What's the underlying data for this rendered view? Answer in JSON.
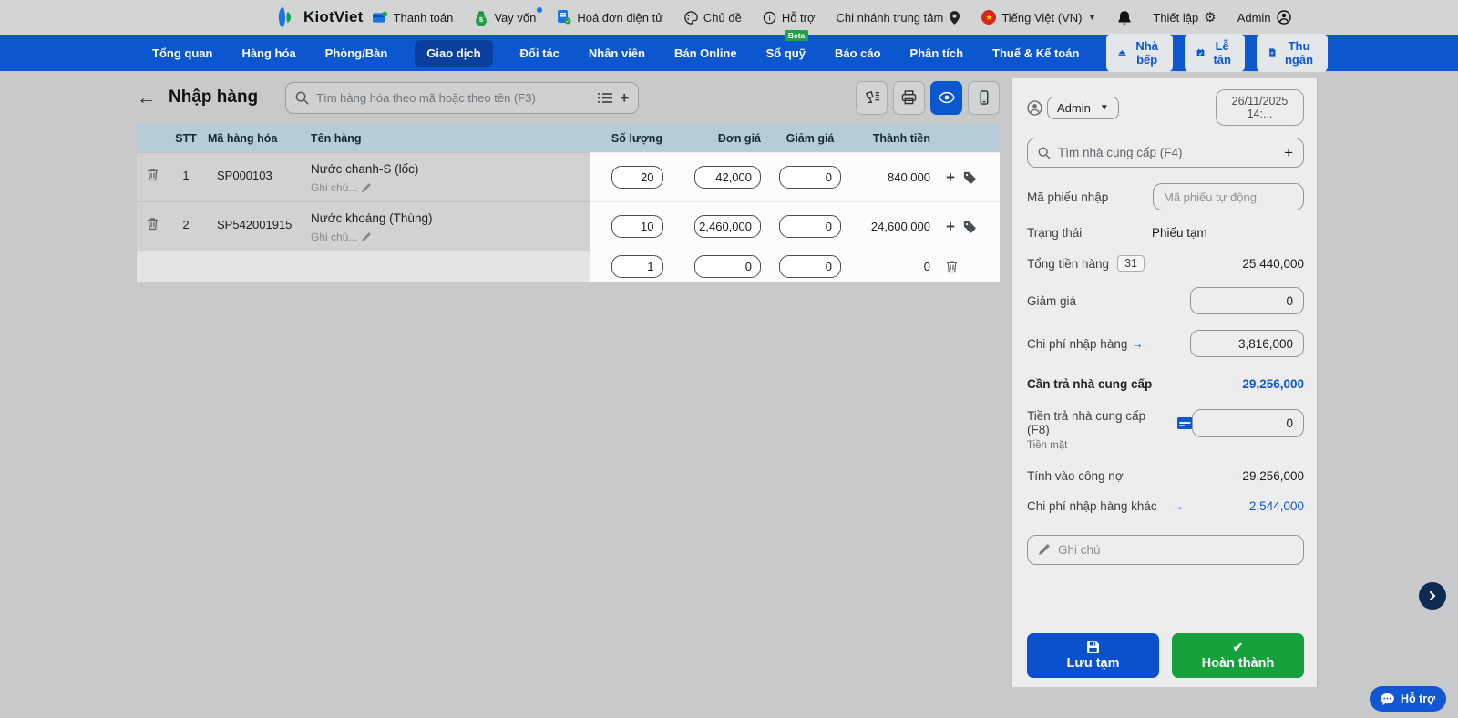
{
  "topbar": {
    "brand": "KiotViet",
    "links": [
      {
        "label": "Thanh toán"
      },
      {
        "label": "Vay vốn"
      },
      {
        "label": "Hoá đơn điện tử"
      },
      {
        "label": "Chủ đề"
      },
      {
        "label": "Hỗ trợ",
        "badge": "Beta"
      },
      {
        "label": "Chi nhánh trung tâm"
      },
      {
        "label": "Tiếng Việt (VN)"
      },
      {
        "label": "Thiết lập"
      },
      {
        "label": "Admin"
      }
    ],
    "flag_star": "★"
  },
  "nav": {
    "items": [
      "Tổng quan",
      "Hàng hóa",
      "Phòng/Bàn",
      "Giao dịch",
      "Đối tác",
      "Nhân viên",
      "Bán Online",
      "Sổ quỹ",
      "Báo cáo",
      "Phân tích",
      "Thuế & Kế toán"
    ],
    "active": "Giao dịch",
    "quick": [
      "Nhà bếp",
      "Lễ tân",
      "Thu ngân"
    ]
  },
  "main": {
    "title": "Nhập hàng",
    "search": {
      "placeholder": "Tìm hàng hóa theo mã hoặc theo tên (F3)"
    },
    "table": {
      "headers": [
        "STT",
        "Mã hàng hóa",
        "Tên hàng",
        "Số lượng",
        "Đơn giá",
        "Giảm giá",
        "Thành tiền"
      ],
      "rows": [
        {
          "stt": "1",
          "code": "SP000103",
          "name": "Nước chanh-S (lốc)",
          "note": "Ghi chú...",
          "qty": "20",
          "price": "42,000",
          "discount": "0",
          "total": "840,000"
        },
        {
          "stt": "2",
          "code": "SP542001915",
          "name": "Nước khoáng (Thùng)",
          "note": "Ghi chú...",
          "qty": "10",
          "price": "2,460,000",
          "discount": "0",
          "total": "24,600,000"
        }
      ],
      "empty_row": {
        "qty": "1",
        "price": "0",
        "discount": "0",
        "total": "0"
      }
    }
  },
  "sidebar": {
    "user": "Admin",
    "datetime": "26/11/2025 14:...",
    "supplier_search": {
      "placeholder": "Tìm nhà cung cấp (F4)"
    },
    "code": {
      "label": "Mã phiếu nhập",
      "placeholder": "Mã phiếu tự động"
    },
    "status": {
      "label": "Trạng thái",
      "value": "Phiếu tạm"
    },
    "total": {
      "label": "Tổng tiền hàng",
      "badge": "31",
      "value": "25,440,000"
    },
    "discount": {
      "label": "Giảm giá",
      "value": "0"
    },
    "cost": {
      "label": "Chi phí nhập hàng",
      "arrow": "→",
      "value": "3,816,000"
    },
    "payable": {
      "label": "Cần trả nhà cung cấp",
      "value": "29,256,000"
    },
    "paid": {
      "label": "Tiền trả nhà cung cấp (F8)",
      "value": "0",
      "method": "Tiền mặt"
    },
    "debt": {
      "label": "Tính vào công nợ",
      "value": "-29,256,000"
    },
    "other_cost": {
      "label": "Chi phí nhập hàng khác",
      "arrow": "→",
      "value": "2,544,000"
    },
    "note": {
      "placeholder": "Ghi chú"
    },
    "buttons": {
      "draft": "Lưu tạm",
      "complete": "Hoàn thành"
    }
  },
  "floating": {
    "support": "Hỗ trợ"
  },
  "colors": {
    "accent_blue": "#0b57d0",
    "success_green": "#17a13c",
    "header_teal": "#b4cdd7"
  }
}
